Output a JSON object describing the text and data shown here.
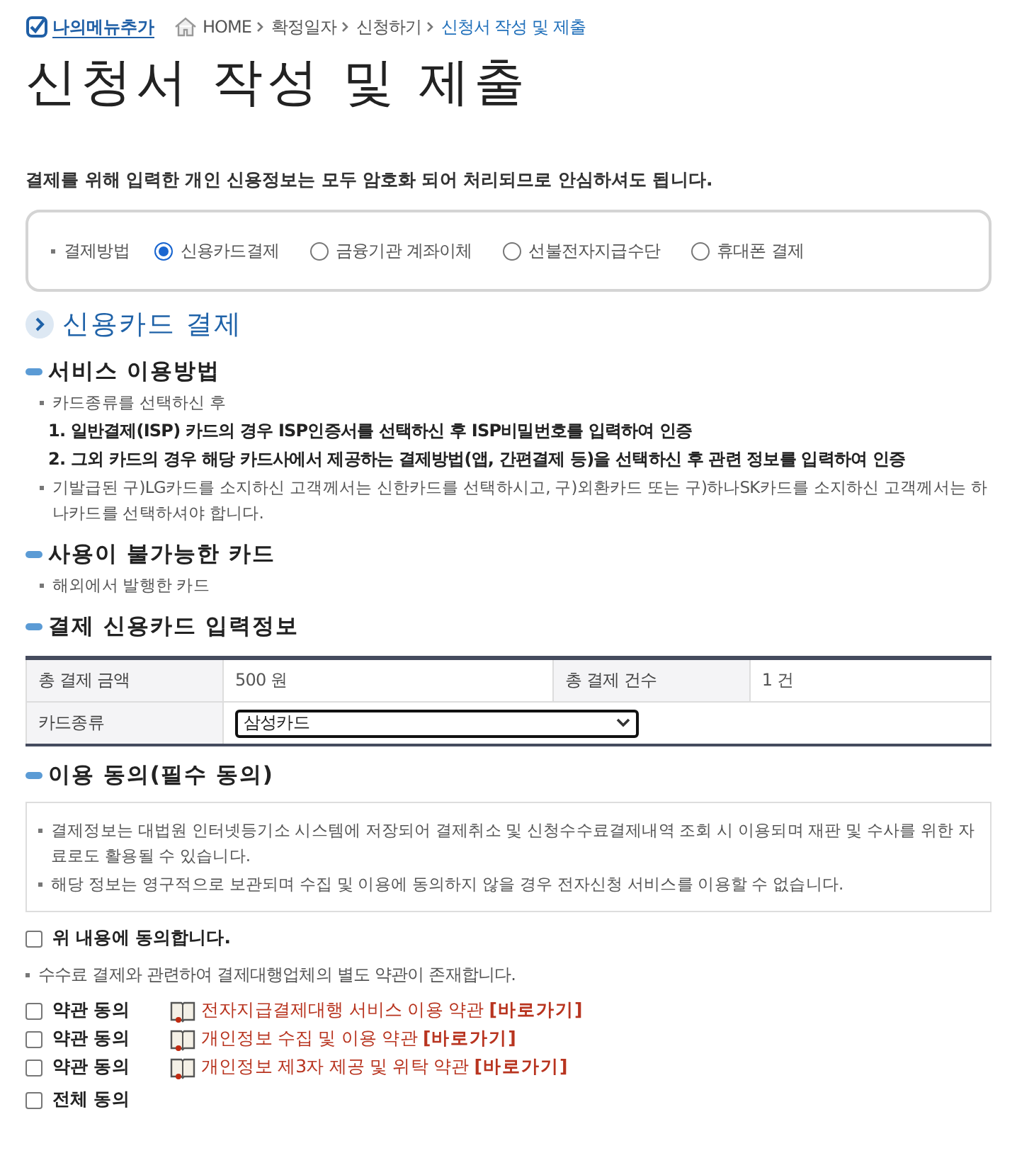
{
  "my_menu": {
    "label": "나의메뉴추가"
  },
  "breadcrumb": [
    {
      "label": "HOME",
      "kind": "home",
      "current": false
    },
    {
      "label": "확정일자",
      "kind": "step",
      "current": false
    },
    {
      "label": "신청하기",
      "kind": "step",
      "current": false
    },
    {
      "label": "신청서 작성 및 제출",
      "kind": "step",
      "current": true
    }
  ],
  "title": "신청서 작성 및 제출",
  "notice": "결제를 위해 입력한 개인 신용정보는 모두 암호화 되어 처리되므로 안심하셔도 됩니다.",
  "payment_method": {
    "label": "결제방법",
    "options": [
      {
        "label": "신용카드결제",
        "selected": true
      },
      {
        "label": "금융기관 계좌이체",
        "selected": false
      },
      {
        "label": "선불전자지급수단",
        "selected": false
      },
      {
        "label": "휴대폰 결제",
        "selected": false
      }
    ]
  },
  "section_title": "신용카드 결제",
  "service_usage": {
    "heading": "서비스 이용방법",
    "items": [
      {
        "kind": "bullet",
        "text": "카드종류를 선택하신 후"
      },
      {
        "kind": "step",
        "text": "1. 일반결제(ISP) 카드의 경우 ISP인증서를 선택하신 후 ISP비밀번호를 입력하여 인증"
      },
      {
        "kind": "step",
        "text": "2. 그외 카드의 경우 해당 카드사에서 제공하는 결제방법(앱, 간편결제 등)을 선택하신 후 관련 정보를 입력하여 인증"
      },
      {
        "kind": "bullet",
        "text": "기발급된 구)LG카드를 소지하신 고객께서는 신한카드를 선택하시고, 구)외환카드 또는 구)하나SK카드를 소지하신 고객께서는 하나카드를 선택하셔야 합니다."
      }
    ]
  },
  "unavailable": {
    "heading": "사용이 불가능한 카드",
    "items": [
      {
        "kind": "bullet",
        "text": "해외에서 발행한 카드"
      }
    ]
  },
  "card_info": {
    "heading": "결제 신용카드 입력정보",
    "total_amount_label": "총 결제 금액",
    "total_amount": "500 원",
    "total_count_label": "총 결제 건수",
    "total_count": "1 건",
    "card_type_label": "카드종류",
    "card_type": "삼성카드"
  },
  "consent": {
    "heading": "이용 동의(필수 동의)",
    "items": [
      "결제정보는 대법원 인터넷등기소 시스템에 저장되어 결제취소 및 신청수수료결제내역 조회 시 이용되며 재판 및 수사를 위한 자료로도 활용될 수 있습니다.",
      "해당 정보는 영구적으로 보관되며 수집 및 이용에 동의하지 않을 경우 전자신청 서비스를 이용할 수 없습니다."
    ],
    "agree": {
      "label": "위 내용에 동의합니다.",
      "checked": false
    },
    "note": "수수료 결제와 관련하여 결제대행업체의 별도 약관이 존재합니다.",
    "terms": [
      {
        "label": "약관 동의",
        "checked": false,
        "title": "전자지급결제대행 서비스 이용 약관",
        "link": "[바로가기]"
      },
      {
        "label": "약관 동의",
        "checked": false,
        "title": "개인정보 수집 및 이용 약관",
        "link": "[바로가기]"
      },
      {
        "label": "약관 동의",
        "checked": false,
        "title": "개인정보 제3자 제공 및 위탁 약관",
        "link": "[바로가기]"
      }
    ],
    "all": {
      "label": "전체 동의",
      "checked": false
    }
  }
}
